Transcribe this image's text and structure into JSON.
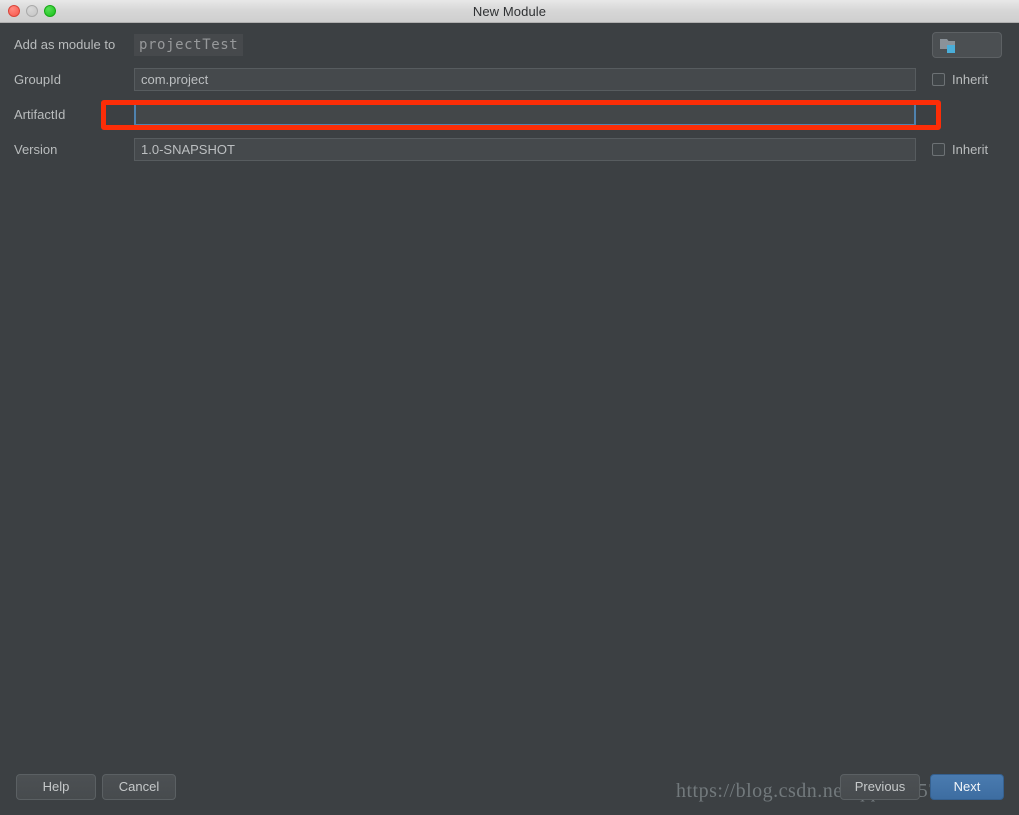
{
  "window": {
    "title": "New Module",
    "controls": {
      "close": "close-button",
      "minimize": "minimize-button",
      "maximize": "maximize-button"
    }
  },
  "form": {
    "add_as_module_to": {
      "label": "Add as module to",
      "value": "projectTest",
      "icon_button": "module-folder-icon"
    },
    "fields": [
      {
        "label": "GroupId",
        "value": "com.project",
        "placeholder": "",
        "inherit_label": "Inherit",
        "inherit_checked": false,
        "focused": false
      },
      {
        "label": "ArtifactId",
        "value": "",
        "placeholder": "",
        "inherit_label": "",
        "inherit_checked": false,
        "focused": true
      },
      {
        "label": "Version",
        "value": "1.0-SNAPSHOT",
        "placeholder": "",
        "inherit_label": "Inherit",
        "inherit_checked": false,
        "focused": false
      }
    ]
  },
  "buttons": {
    "help": "Help",
    "cancel": "Cancel",
    "previous": "Previous",
    "next": "Next"
  },
  "annotation": {
    "type": "red-rectangle-highlight",
    "target": "ArtifactId"
  },
  "watermark": {
    "text": "https://blog.csdn.net/qq_30257149"
  },
  "colors": {
    "background": "#3c4043",
    "field_background": "#45494c",
    "field_border": "#575c5f",
    "text": "#b9bcbd",
    "titlebar": "#d6d6d6",
    "focus_blue": "#4f82ae",
    "accent_blue": "#4a7bb0",
    "highlight_red": "#fc2d07",
    "icon_blue": "#4aaed9"
  }
}
